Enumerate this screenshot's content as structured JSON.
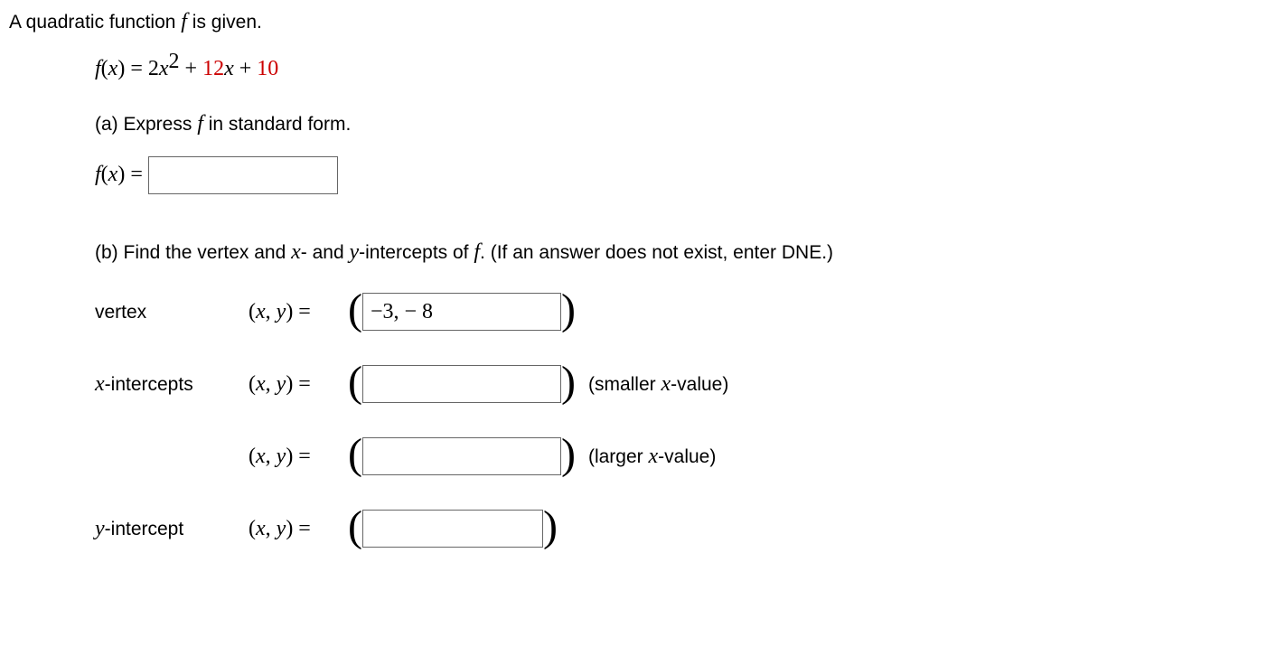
{
  "intro_pre": "A quadratic function ",
  "intro_f": "f",
  "intro_post": " is given.",
  "eq": {
    "lhs_f": "f",
    "lhs_open": "(",
    "lhs_x": "x",
    "lhs_close": ") = 2",
    "x2": "x",
    "sup2": "2",
    "plus1": " + ",
    "c1": "12",
    "x1": "x",
    "plus2": " + ",
    "c2": "10"
  },
  "part_a": {
    "label": "(a) Express ",
    "f": "f",
    "rest": " in standard form.",
    "fx_f": "f",
    "fx_open": "(",
    "fx_x": "x",
    "fx_close": ") = "
  },
  "part_b": {
    "pre": "(b) Find the vertex and ",
    "x": "x",
    "mid1": "- and ",
    "y": "y",
    "mid2": "-intercepts of ",
    "f": "f",
    "post": ". (If an answer does not exist, enter DNE.)"
  },
  "labels": {
    "vertex": "vertex",
    "x_intercepts_pre_i": "x",
    "x_intercepts_post": "-intercepts",
    "y_intercept_pre_i": "y",
    "y_intercept_post": "-intercept",
    "smaller_pre": "(smaller ",
    "smaller_i": "x",
    "smaller_post": "-value)",
    "larger_pre": "(larger ",
    "larger_i": "x",
    "larger_post": "-value)"
  },
  "xy": {
    "open": "(",
    "x": "x",
    "comma": ", ",
    "y": "y",
    "close": ") = "
  },
  "paren": {
    "open": "(",
    "close": ")"
  },
  "values": {
    "standard_form": "",
    "vertex": "−3, − 8",
    "x1": "",
    "x2": "",
    "yint": ""
  }
}
